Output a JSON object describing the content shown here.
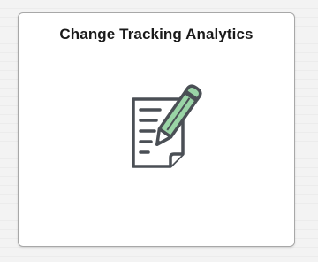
{
  "tile": {
    "title": "Change Tracking Analytics",
    "icon": "document-edit-icon"
  },
  "colors": {
    "tile_background": "#ffffff",
    "tile_border": "#a8a8a8",
    "icon_stroke": "#4a4f55",
    "pencil_fill": "#9ad4a6",
    "title_text": "#1a1a1a"
  }
}
